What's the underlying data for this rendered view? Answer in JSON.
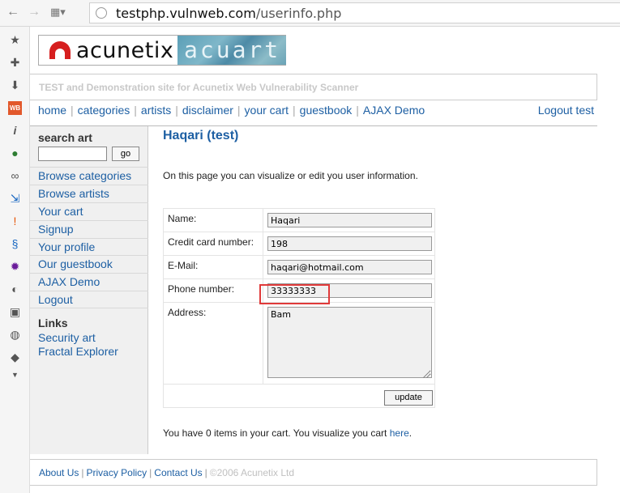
{
  "browser": {
    "url_host": "testphp.vulnweb.com",
    "url_path": "/userinfo.php"
  },
  "header": {
    "logo_left": "acunetix",
    "logo_right": "acuart",
    "tagline": "TEST and Demonstration site for Acunetix Web Vulnerability Scanner"
  },
  "topnav": {
    "items": [
      "home",
      "categories",
      "artists",
      "disclaimer",
      "your cart",
      "guestbook",
      "AJAX Demo"
    ],
    "logout": "Logout test"
  },
  "sidebar": {
    "search_title": "search art",
    "search_value": "",
    "search_button": "go",
    "menu": [
      "Browse categories",
      "Browse artists",
      "Your cart",
      "Signup",
      "Your profile",
      "Our guestbook",
      "AJAX Demo",
      "Logout"
    ],
    "links_title": "Links",
    "links": [
      "Security art",
      "Fractal Explorer"
    ]
  },
  "main": {
    "title": "Haqari (test)",
    "intro": "On this page you can visualize or edit you user information.",
    "form": {
      "name_label": "Name:",
      "name_value": "Haqari",
      "cc_label": "Credit card number:",
      "cc_value": "198",
      "email_label": "E-Mail:",
      "email_value": "haqari@hotmail.com",
      "phone_label": "Phone number:",
      "phone_value": "33333333",
      "address_label": "Address:",
      "address_value": "Bam",
      "update_button": "update"
    },
    "cart_text": "You have 0 items in your cart. You visualize you cart ",
    "cart_link": "here",
    "cart_end": "."
  },
  "footer": {
    "about": "About Us",
    "privacy": "Privacy Policy",
    "contact": "Contact Us",
    "copyright": "©2006 Acunetix Ltd"
  },
  "colors": {
    "link": "#1d5fa3",
    "highlight": "#e03a3a"
  }
}
